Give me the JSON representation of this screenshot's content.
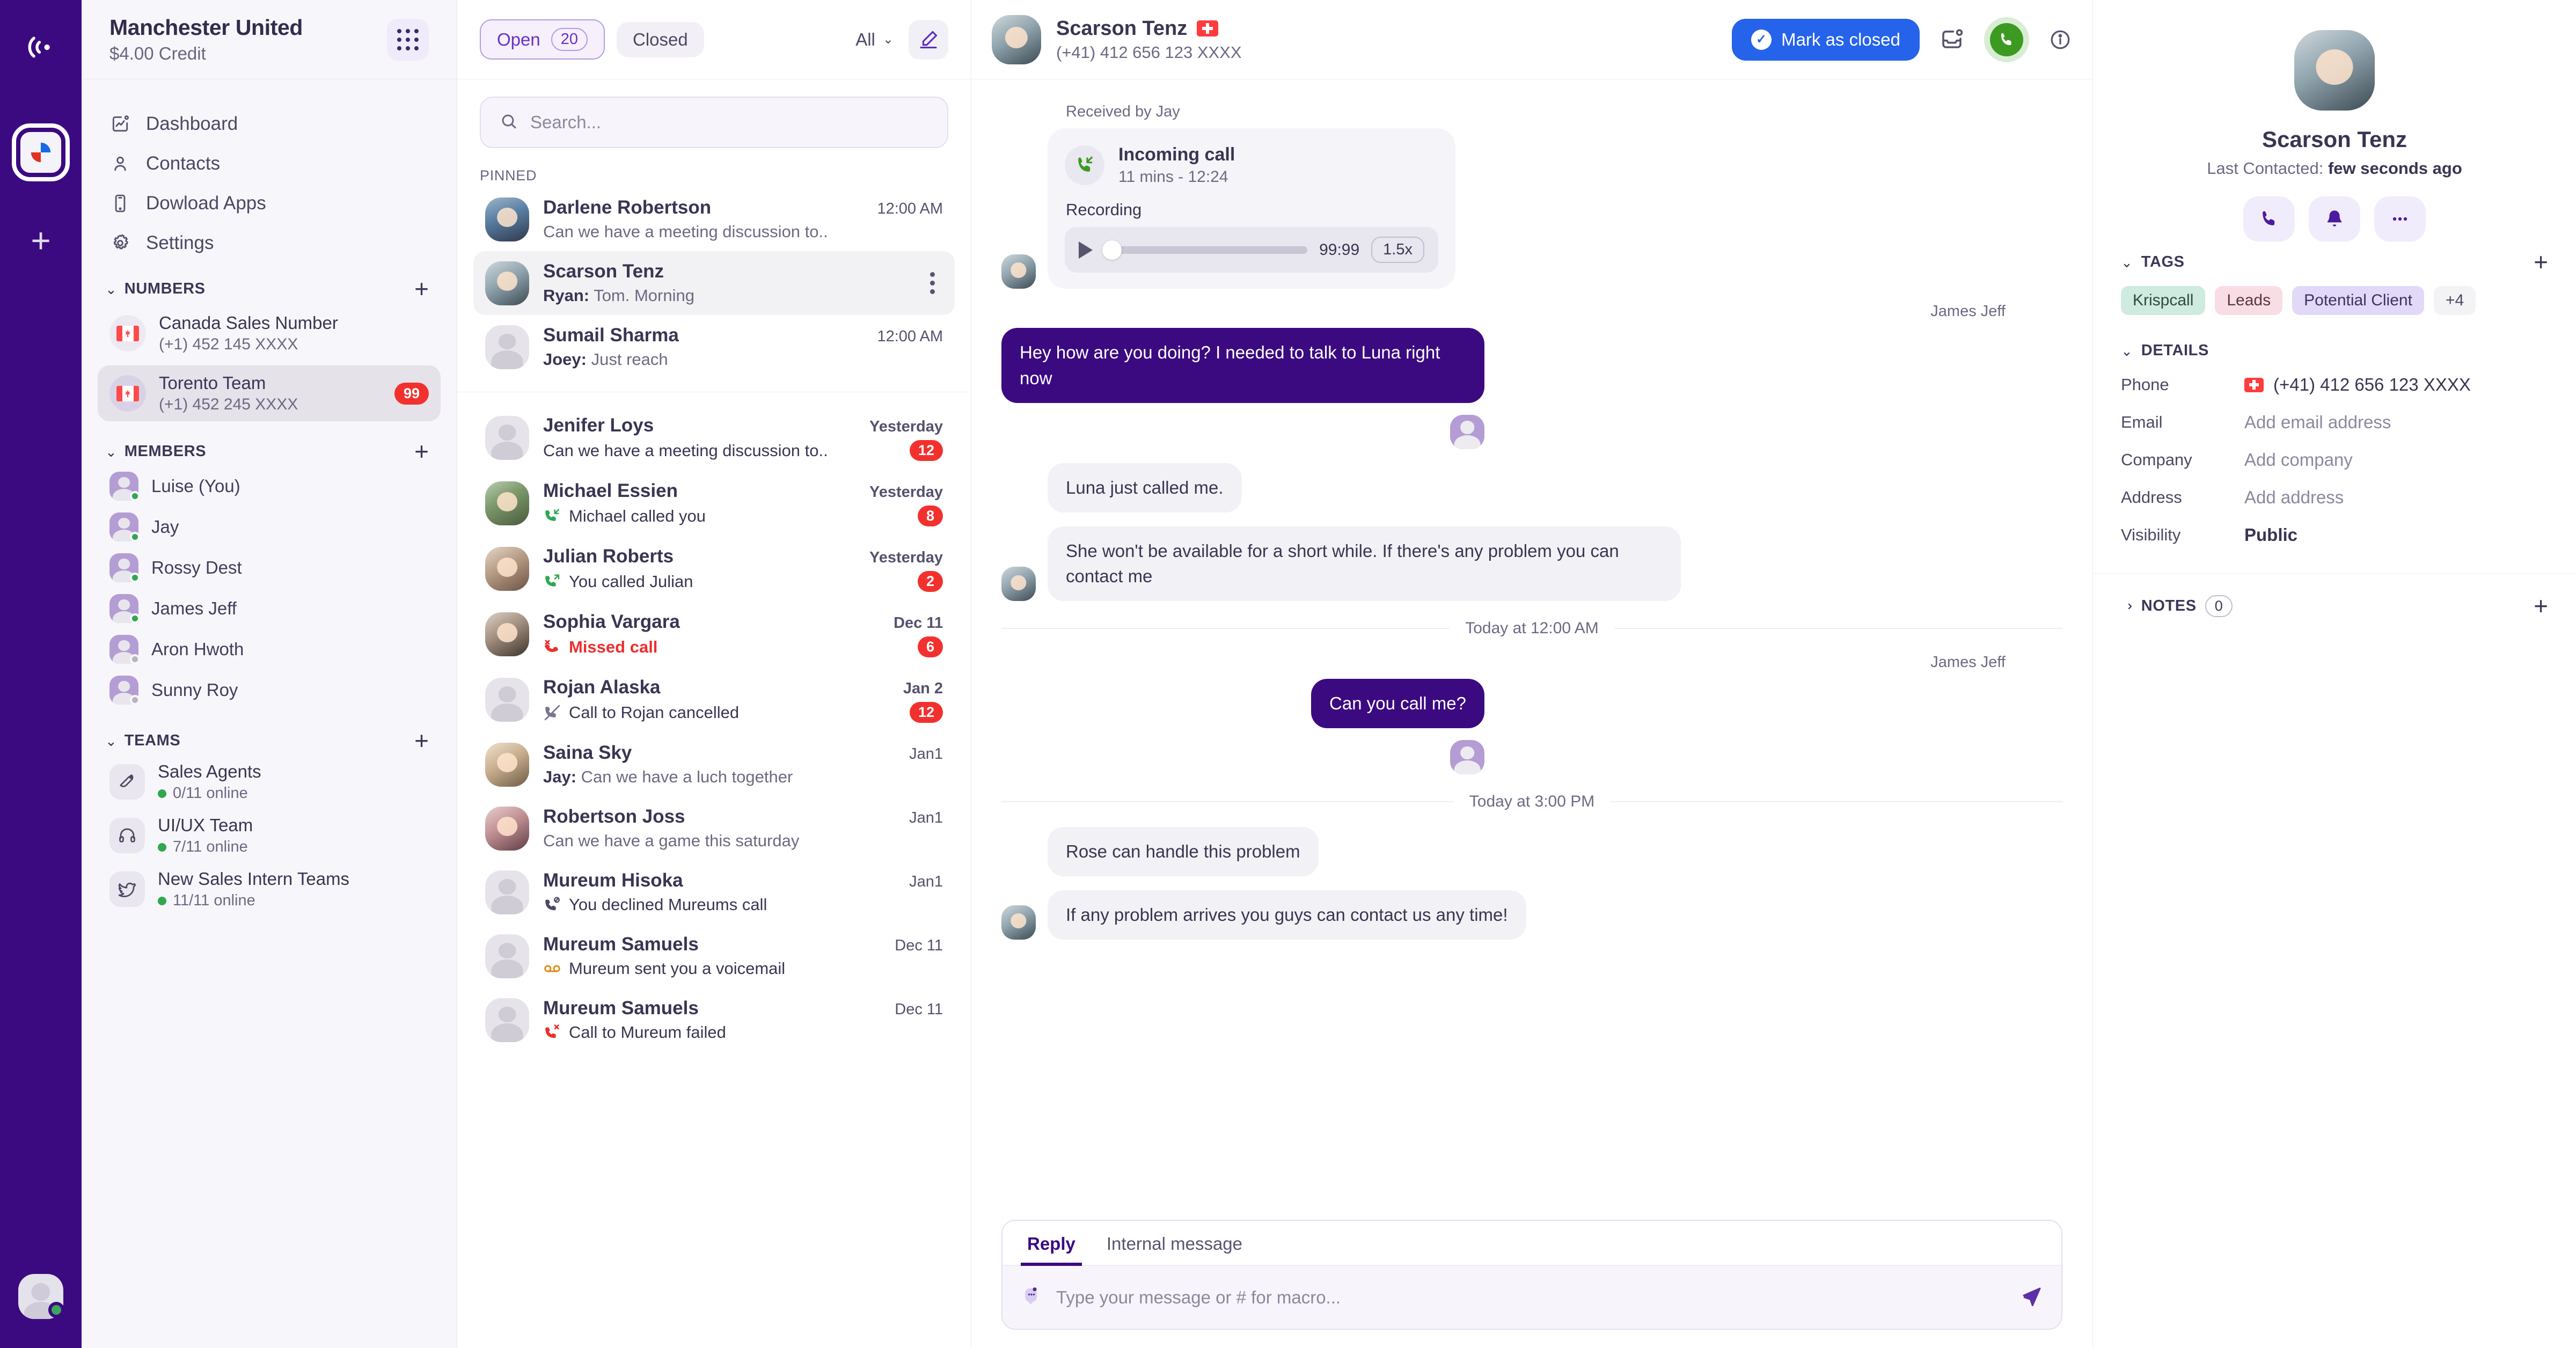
{
  "rail": {
    "logo_icon": "broadcast-icon",
    "workspace_icon": "krispcall-app-icon",
    "add_label": "+",
    "user_status": "online"
  },
  "sidebar": {
    "org": {
      "name": "Manchester United",
      "credit": "$4.00 Credit"
    },
    "grid_icon": "dialpad-icon",
    "nav": [
      {
        "label": "Dashboard",
        "icon": "dashboard-icon"
      },
      {
        "label": "Contacts",
        "icon": "contacts-icon"
      },
      {
        "label": "Dowload Apps",
        "icon": "mobile-icon"
      },
      {
        "label": "Settings",
        "icon": "gear-icon"
      }
    ],
    "numbers": {
      "title": "NUMBERS",
      "add": "+",
      "items": [
        {
          "name": "Canada Sales Number",
          "number": "(+1) 452 145 XXXX",
          "flag": "canada",
          "badge": "",
          "active": false
        },
        {
          "name": "Torento Team",
          "number": "(+1) 452 245 XXXX",
          "flag": "canada",
          "badge": "99",
          "active": true
        }
      ]
    },
    "members": {
      "title": "MEMBERS",
      "add": "+",
      "items": [
        {
          "name": "Luise (You)",
          "status": "online"
        },
        {
          "name": "Jay",
          "status": "online"
        },
        {
          "name": "Rossy Dest",
          "status": "online"
        },
        {
          "name": "James Jeff",
          "status": "online"
        },
        {
          "name": "Aron Hwoth",
          "status": "offline"
        },
        {
          "name": "Sunny Roy",
          "status": "offline"
        }
      ]
    },
    "teams": {
      "title": "TEAMS",
      "add": "+",
      "items": [
        {
          "name": "Sales Agents",
          "online": "0/11 online",
          "icon": "brush-icon"
        },
        {
          "name": "UI/UX Team",
          "online": "7/11 online",
          "icon": "headset-icon"
        },
        {
          "name": "New Sales Intern Teams",
          "online": "11/11 online",
          "icon": "bird-icon"
        }
      ]
    }
  },
  "convlist": {
    "tabs": {
      "open_label": "Open",
      "open_count": "20",
      "closed_label": "Closed"
    },
    "filter_label": "All",
    "compose_icon": "compose-icon",
    "search": {
      "placeholder": "Search...",
      "value": "",
      "icon": "search-icon"
    },
    "pinned_label": "PINNED",
    "pinned": [
      {
        "name": "Darlene Robertson",
        "preview": "Can we have a meeting discussion to..",
        "time": "12:00 AM",
        "badge": "",
        "sender": "",
        "icon": "",
        "avatar": "ph1",
        "active": false
      },
      {
        "name": "Scarson Tenz",
        "preview": "Tom. Morning",
        "sender": "Ryan:",
        "time": "",
        "badge": "",
        "icon": "",
        "avatar": "ph2",
        "active": true
      },
      {
        "name": "Sumail Sharma",
        "preview": "Just reach",
        "sender": "Joey:",
        "time": "12:00 AM",
        "badge": "",
        "icon": "",
        "avatar": "generic",
        "active": false
      }
    ],
    "items": [
      {
        "name": "Jenifer Loys",
        "preview": "Can we have a meeting discussion to..",
        "sender": "",
        "time": "Yesterday",
        "time_bold": true,
        "badge": "12",
        "icon": "",
        "avatar": "generic",
        "preview_style": "dark"
      },
      {
        "name": "Michael Essien",
        "preview": "Michael called you",
        "sender": "",
        "time": "Yesterday",
        "time_bold": true,
        "badge": "8",
        "icon": "call-incoming-icon",
        "avatar": "ph3",
        "preview_style": "dark"
      },
      {
        "name": "Julian Roberts",
        "preview": "You called Julian",
        "sender": "",
        "time": "Yesterday",
        "time_bold": true,
        "badge": "2",
        "icon": "call-outgoing-icon",
        "avatar": "ph4",
        "preview_style": "dark"
      },
      {
        "name": "Sophia Vargara",
        "preview": "Missed call",
        "sender": "",
        "time": "Dec 11",
        "time_bold": true,
        "badge": "6",
        "icon": "call-missed-icon",
        "avatar": "ph5",
        "preview_style": "red"
      },
      {
        "name": "Rojan Alaska",
        "preview": "Call to Rojan cancelled",
        "sender": "",
        "time": "Jan 2",
        "time_bold": true,
        "badge": "12",
        "icon": "call-cancelled-icon",
        "avatar": "generic",
        "preview_style": "dark"
      },
      {
        "name": "Saina Sky",
        "preview": "Can we have a luch together",
        "sender": "Jay:",
        "time": "Jan1",
        "time_bold": false,
        "badge": "",
        "icon": "",
        "avatar": "ph6",
        "preview_style": ""
      },
      {
        "name": "Robertson Joss",
        "preview": "Can we have a game this saturday",
        "sender": "",
        "time": "Jan1",
        "time_bold": false,
        "badge": "",
        "icon": "",
        "avatar": "ph7",
        "preview_style": ""
      },
      {
        "name": "Mureum Hisoka",
        "preview": "You declined Mureums call",
        "sender": "",
        "time": "Jan1",
        "time_bold": false,
        "badge": "",
        "icon": "call-declined-icon",
        "avatar": "generic",
        "preview_style": "dark"
      },
      {
        "name": "Mureum Samuels",
        "preview": "Mureum sent you a voicemail",
        "sender": "",
        "time": "Dec 11",
        "time_bold": false,
        "badge": "",
        "icon": "voicemail-icon",
        "avatar": "generic",
        "preview_style": "dark"
      },
      {
        "name": "Mureum Samuels",
        "preview": "Call to Mureum failed",
        "sender": "",
        "time": "Dec 11",
        "time_bold": false,
        "badge": "",
        "icon": "call-failed-icon",
        "avatar": "generic",
        "preview_style": "dark"
      }
    ]
  },
  "chat": {
    "header": {
      "name": "Scarson Tenz",
      "flag": "switzerland",
      "number": "(+41) 412 656 123 XXXX",
      "mark_closed_label": "Mark as closed",
      "inbox_icon": "move-to-inbox-icon",
      "call_icon": "phone-call-icon",
      "info_icon": "info-icon"
    },
    "received_by": "Received by Jay",
    "call_card": {
      "title": "Incoming call",
      "subtitle": "11 mins - 12:24",
      "recording_label": "Recording",
      "duration": "99:99",
      "speed": "1.5x",
      "play_icon": "play-icon"
    },
    "messages": [
      {
        "kind": "sender-label",
        "text": "James Jeff"
      },
      {
        "kind": "out",
        "text": "Hey how are you doing? I needed to talk to Luna right now"
      },
      {
        "kind": "in",
        "text": "Luna just called me."
      },
      {
        "kind": "in",
        "text": "She won't be available for a short while. If there's any problem you can contact me"
      },
      {
        "kind": "day",
        "text": "Today at 12:00 AM"
      },
      {
        "kind": "sender-label",
        "text": "James Jeff"
      },
      {
        "kind": "out",
        "text": "Can you call me?"
      },
      {
        "kind": "day",
        "text": "Today at 3:00 PM"
      },
      {
        "kind": "in",
        "text": "Rose can handle this problem"
      },
      {
        "kind": "in",
        "text": "If any problem arrives you guys can contact us any time!"
      }
    ],
    "composer": {
      "tabs": [
        {
          "label": "Reply",
          "active": true
        },
        {
          "label": "Internal message",
          "active": false
        }
      ],
      "placeholder": "Type your message or # for macro...",
      "value": "",
      "emoji_icon": "emoji-icon",
      "send_icon": "send-icon"
    }
  },
  "right": {
    "name": "Scarson Tenz",
    "last_contacted_label": "Last Contacted:",
    "last_contacted_value": "few seconds ago",
    "actions": [
      {
        "icon": "phone-icon",
        "name": "call"
      },
      {
        "icon": "bell-icon",
        "name": "notification"
      },
      {
        "icon": "more-icon",
        "name": "more"
      }
    ],
    "tags": {
      "title": "TAGS",
      "add": "+",
      "items": [
        {
          "label": "Krispcall",
          "color": "#CFEADF"
        },
        {
          "label": "Leads",
          "color": "#F8DDE5"
        },
        {
          "label": "Potential Client",
          "color": "#E2D8F8"
        },
        {
          "label": "+4",
          "color": "#F3F2F5"
        }
      ]
    },
    "details": {
      "title": "DETAILS",
      "rows": [
        {
          "key": "Phone",
          "value": "(+41) 412 656 123 XXXX",
          "flag": "switzerland",
          "placeholder": false,
          "bold": false
        },
        {
          "key": "Email",
          "value": "Add email address",
          "flag": "",
          "placeholder": true,
          "bold": false
        },
        {
          "key": "Company",
          "value": "Add company",
          "flag": "",
          "placeholder": true,
          "bold": false
        },
        {
          "key": "Address",
          "value": "Add address",
          "flag": "",
          "placeholder": true,
          "bold": false
        },
        {
          "key": "Visibility",
          "value": "Public",
          "flag": "",
          "placeholder": false,
          "bold": true
        }
      ]
    },
    "notes": {
      "title": "NOTES",
      "count": "0",
      "add": "+"
    }
  },
  "colors": {
    "brand_purple": "#3B0A81",
    "accent_blue": "#2563EB",
    "badge_red": "#F2312F",
    "green": "#3C9A21",
    "sidebar_bg": "#F7F6FA"
  }
}
